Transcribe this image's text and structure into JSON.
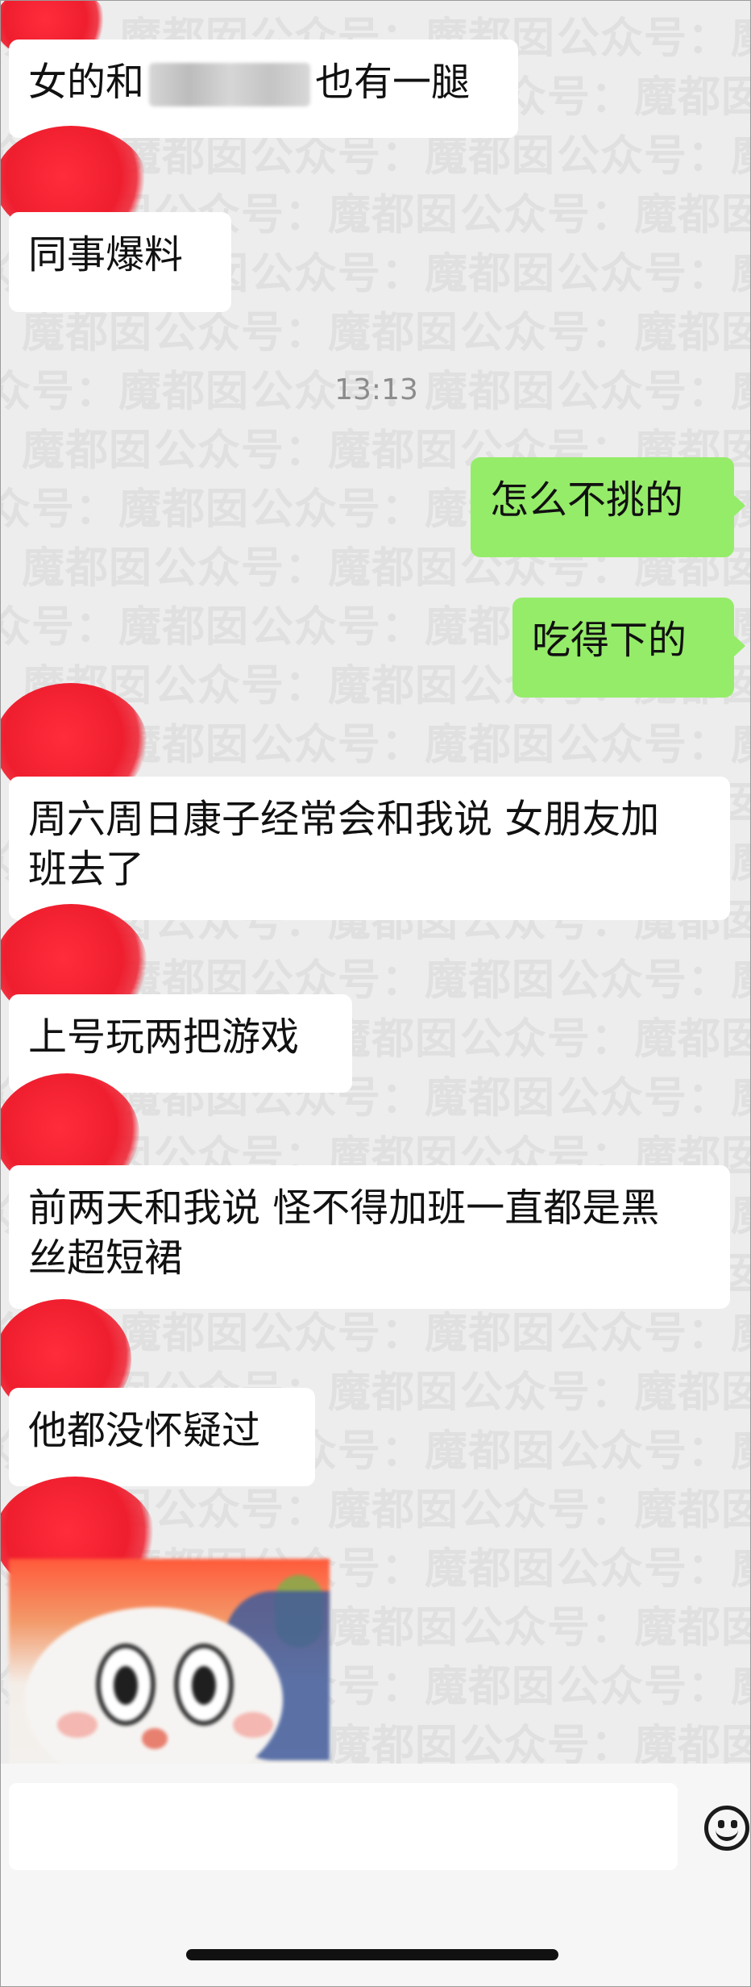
{
  "chat": {
    "time_divider": "13:13",
    "messages": [
      {
        "from": "other",
        "text_before": "女的和",
        "text_after": "也有一腿"
      },
      {
        "from": "other",
        "text": "同事爆料"
      },
      {
        "from": "me",
        "text": "怎么不挑的"
      },
      {
        "from": "me",
        "text": "吃得下的"
      },
      {
        "from": "other",
        "line1": "周六周日康子经常会和我说 女朋友加",
        "line2": "班去了"
      },
      {
        "from": "other",
        "text": "上号玩两把游戏"
      },
      {
        "from": "other",
        "line1": "前两天和我说 怪不得加班一直都是黑",
        "line2": "丝超短裙"
      },
      {
        "from": "other",
        "text": "他都没怀疑过"
      }
    ]
  },
  "watermark": {
    "text": "公众号：魔都囡"
  },
  "input": {
    "value": ""
  },
  "icons": {
    "emoji": "emoji-icon"
  },
  "colors": {
    "my_bubble": "#95ec69",
    "other_bubble": "#ffffff",
    "background": "#ededed",
    "avatar_redaction": "#ef1e2e"
  }
}
